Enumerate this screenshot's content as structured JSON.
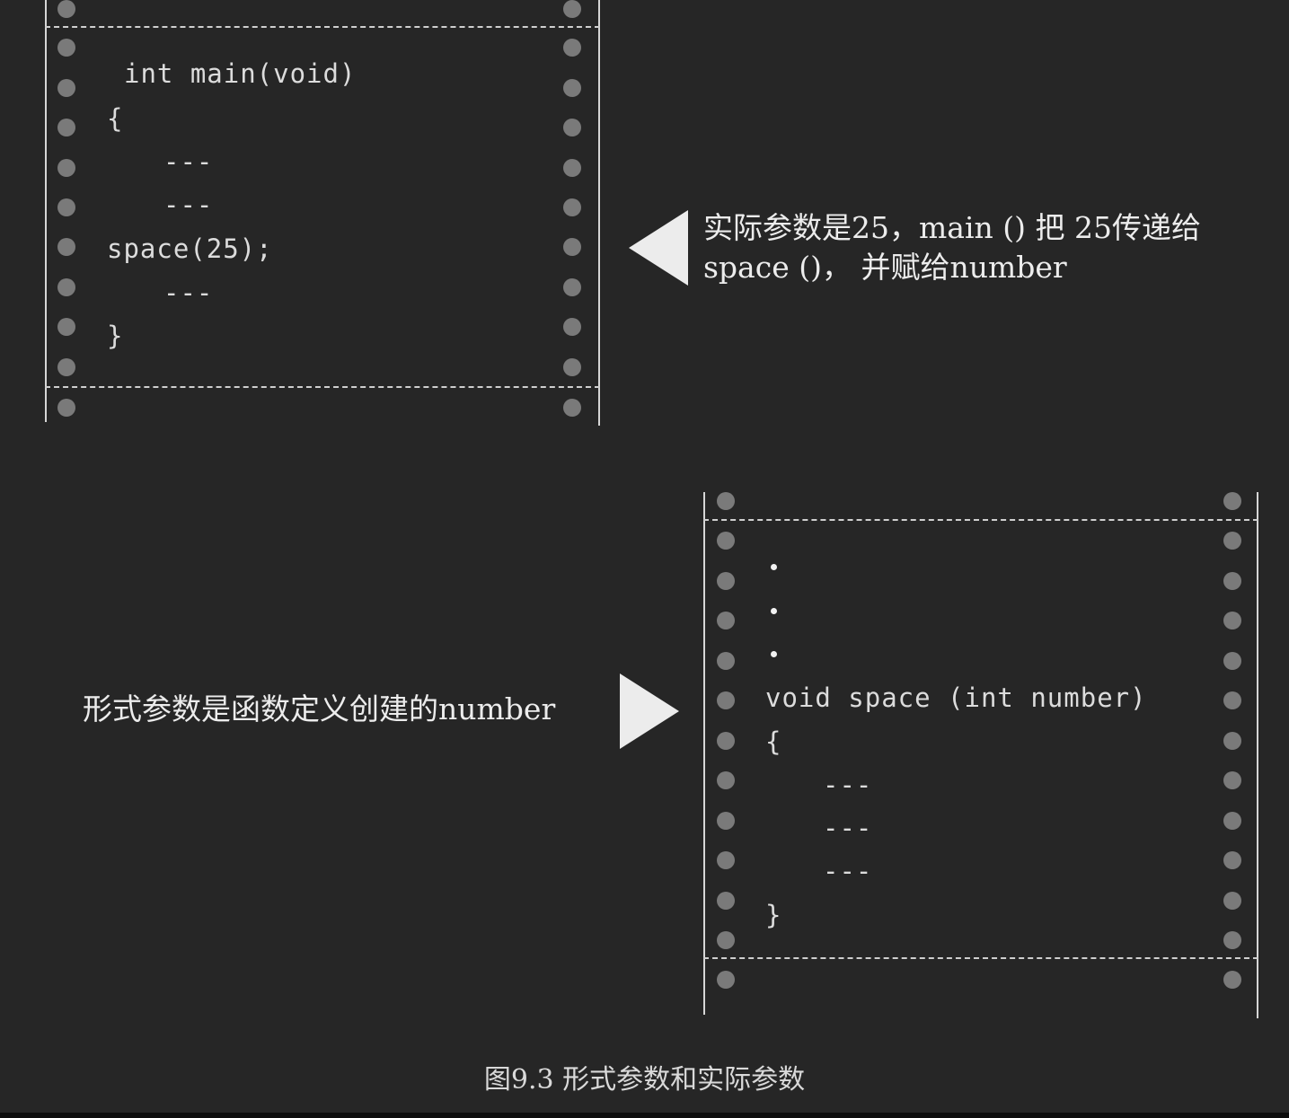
{
  "main_panel": {
    "code_lines": [
      "int main(void)",
      "{",
      "---",
      "---",
      "space(25);",
      "---",
      "}"
    ]
  },
  "space_panel": {
    "code_lines": [
      "void space (int number)",
      "{",
      "---",
      "---",
      "---",
      "}"
    ]
  },
  "annotations": {
    "actual_line1": "实际参数是25，main () 把 25传递给",
    "actual_line2": "space ()， 并赋给number",
    "formal": "形式参数是函数定义创建的number"
  },
  "caption": "图9.3 形式参数和实际参数",
  "colors": {
    "background": "#262626",
    "text": "#ececec",
    "holes": "#7a7a7a",
    "arrow": "#ececec"
  },
  "icons": {
    "left_arrow": "left-triangle-icon",
    "right_arrow": "right-triangle-icon"
  }
}
